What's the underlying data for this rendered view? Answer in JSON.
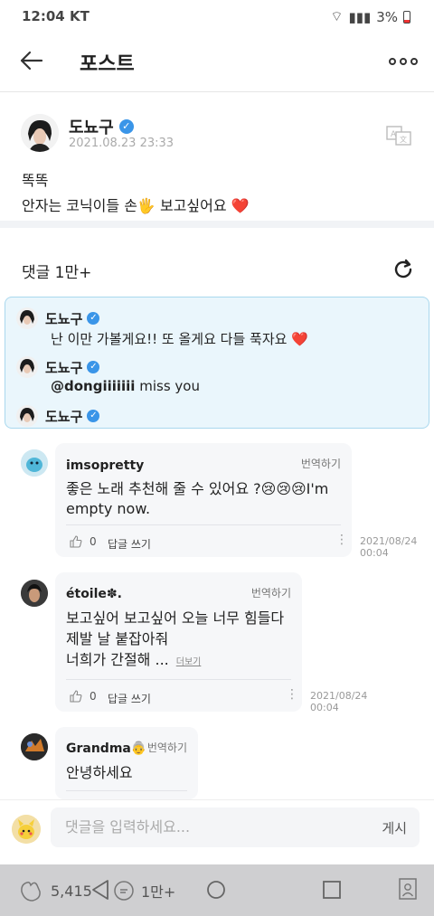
{
  "status": {
    "time": "12:04 KT",
    "battery": "3%"
  },
  "header": {
    "title": "포스트"
  },
  "post": {
    "author": "도뇨구",
    "date": "2021.08.23 23:33",
    "line1": "똑똑",
    "line2": "안자는 코닉이들 손🖐 보고싶어요 ❤️"
  },
  "comments": {
    "title": "댓글 1만+",
    "pinned": [
      {
        "name": "도뇨구",
        "text": "난 이만 가볼게요!! 또 올게요 다들 푹자요 ❤️",
        "mention": ""
      },
      {
        "name": "도뇨구",
        "mention": "@dongiiiiiii",
        "text": " miss you"
      },
      {
        "name": "도뇨구",
        "mention": "",
        "text": ""
      }
    ],
    "items": [
      {
        "user": "imsopretty",
        "translate": "번역하기",
        "body1": "좋은 노래 추천해 줄 수 있어요 ?😢😢😢I'm",
        "body2": "empty now.",
        "likes": "0",
        "reply": "답글 쓰기",
        "date1": "2021/08/24",
        "date2": "00:04"
      },
      {
        "user": "étoile✽.",
        "translate": "번역하기",
        "body1": "보고싶어 보고싶어 오늘 너무 힘들다",
        "body2": "제발 날 붙잡아줘",
        "body3": "너희가 간절해 ...",
        "more": "더보기",
        "likes": "0",
        "reply": "답글 쓰기",
        "date1": "2021/08/24",
        "date2": "00:04"
      },
      {
        "user": "Grandma👵",
        "translate": "번역하기",
        "body1": "안녕하세요"
      }
    ]
  },
  "input": {
    "placeholder": "댓글을 입력하세요...",
    "post_label": "게시"
  },
  "bottom": {
    "likes": "5,415",
    "comments": "1만+"
  },
  "colors": {
    "accent": "#3a95e8",
    "pinned_bg": "#eaf6fc",
    "pinned_border": "#a9d8ee",
    "heart": "#e0202f"
  }
}
